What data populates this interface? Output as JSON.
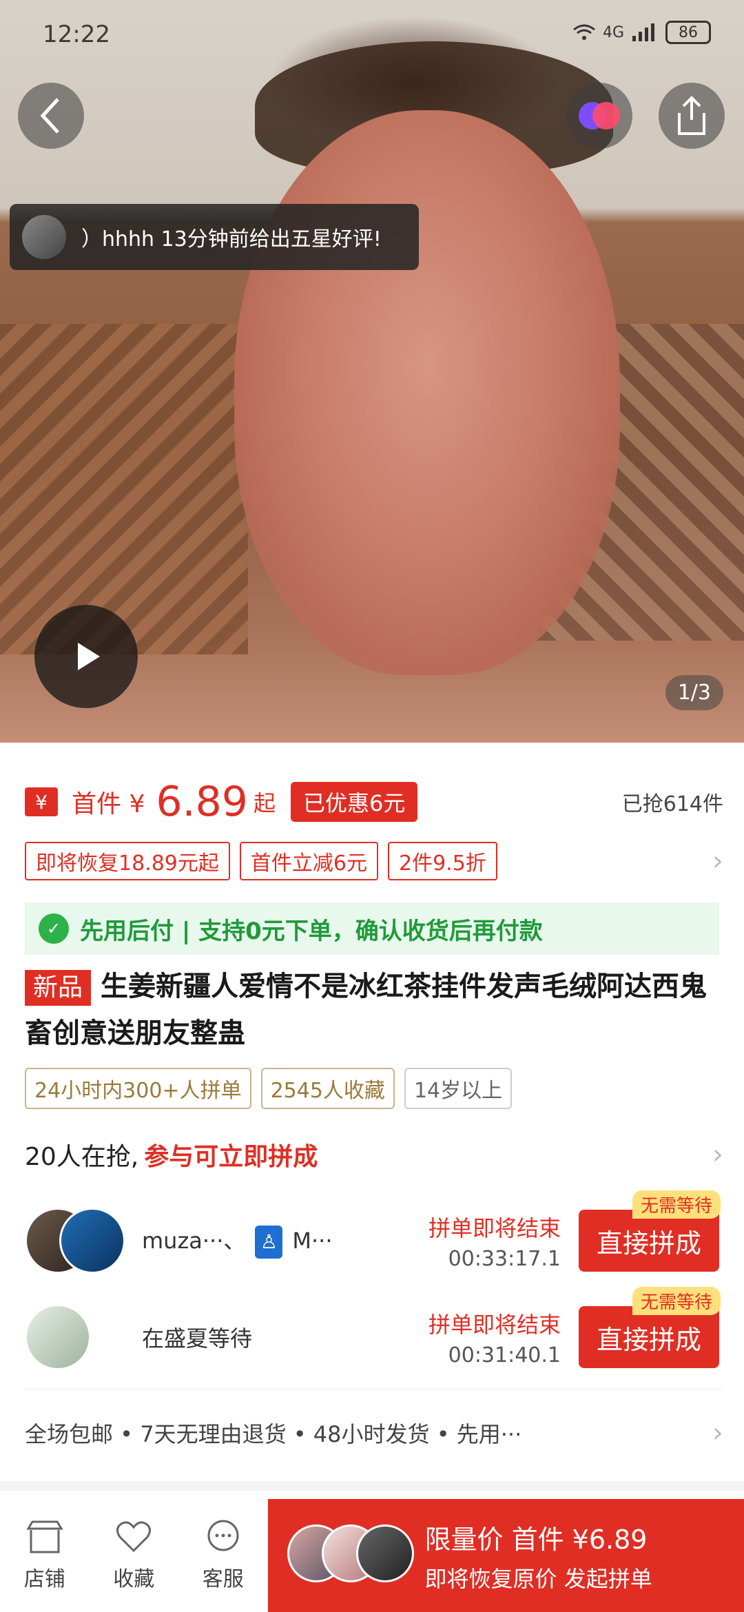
{
  "status": {
    "time": "12:22",
    "network": "4G",
    "battery": "86"
  },
  "hero": {
    "toast_text": "）hhhh 13分钟前给出五星好评!",
    "page_indicator": "1/3"
  },
  "price": {
    "yen_tag": "¥",
    "prefix": "首件 ¥",
    "amount": "6.89",
    "suffix": "起",
    "discount_badge": "已优惠6元",
    "sold": "已抢614件"
  },
  "coupons": [
    "即将恢复18.89元起",
    "首件立减6元",
    "2件9.5折"
  ],
  "paylater": "先用后付 | 支持0元下单，确认收货后再付款",
  "product": {
    "new_tag": "新品",
    "title": "生姜新疆人爱情不是冰红茶挂件发声毛绒阿达西鬼畜创意送朋友整蛊"
  },
  "tags": [
    "24小时内300+人拼单",
    "2545人收藏",
    "14岁以上"
  ],
  "grab": {
    "count_text": "20人在抢,",
    "highlight": "参与可立即拼成"
  },
  "groups": [
    {
      "name_a": "muza···、",
      "name_b": "M···",
      "ends_text": "拼单即将结束",
      "timer": "00:33:17.1",
      "badge": "无需等待",
      "button": "直接拼成"
    },
    {
      "name_a": "在盛夏等待",
      "ends_text": "拼单即将结束",
      "timer": "00:31:40.1",
      "badge": "无需等待",
      "button": "直接拼成"
    }
  ],
  "services": "全场包邮 • 7天无理由退货 • 48小时发货 • 先用···",
  "bottom_bar": {
    "shop": "店铺",
    "favorite": "收藏",
    "service": "客服",
    "cta_line1": "限量价 首件 ¥6.89",
    "cta_line2": "即将恢复原价 发起拼单"
  },
  "colors": {
    "accent": "#e02e24",
    "paylater": "#1f9a3a"
  }
}
